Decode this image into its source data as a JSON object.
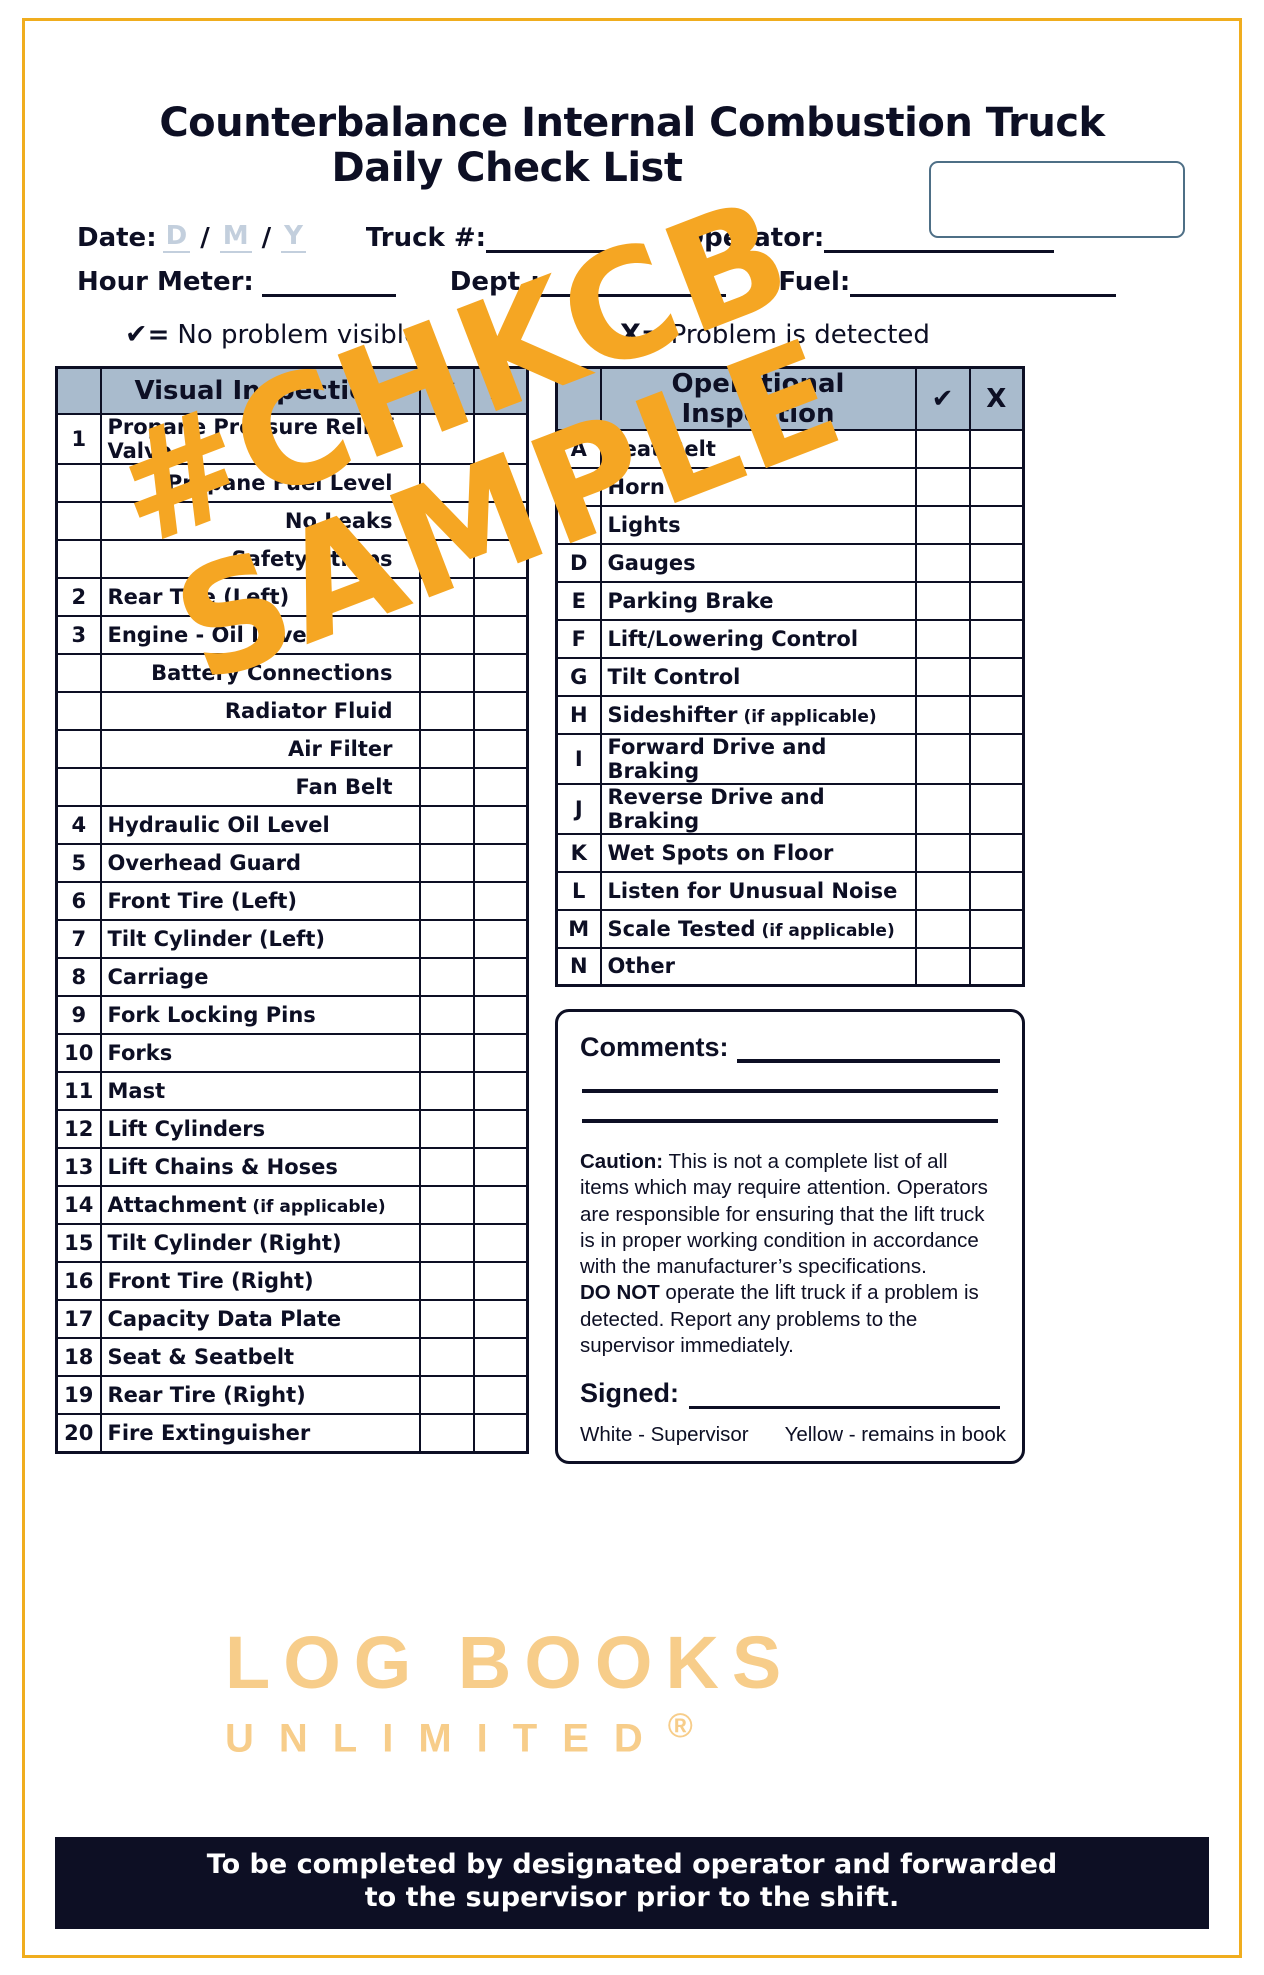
{
  "title": {
    "line1": "Counterbalance Internal Combustion Truck",
    "line2": "Daily Check List"
  },
  "header_fields": {
    "date_label": "Date:",
    "date_day": "D",
    "date_sep1": "/",
    "date_month": "M",
    "date_sep2": "/",
    "date_year": "Y",
    "truck_label": "Truck #:",
    "operator_label": "Operator:",
    "hour_meter_label": "Hour Meter:",
    "dept_label": "Dept.:",
    "fuel_label": "Fuel:"
  },
  "legend": {
    "check_symbol": "✔",
    "check_equals": "=",
    "check_text": "No problem visible",
    "x_symbol": "X",
    "x_equals": "=",
    "x_text": "Problem is detected"
  },
  "visual_table": {
    "header_title": "Visual Inspection",
    "header_check": "✔",
    "header_x": "X",
    "rows": [
      {
        "num": "1",
        "item": "Propane Pressure Relief Valve",
        "sub": false
      },
      {
        "num": "",
        "item": "Propane Fuel Level",
        "sub": true
      },
      {
        "num": "",
        "item": "No Leaks",
        "sub": true
      },
      {
        "num": "",
        "item": "Safety Straps",
        "sub": true
      },
      {
        "num": "2",
        "item": "Rear Tire (Left)",
        "sub": false
      },
      {
        "num": "3",
        "item": "Engine - Oil Level",
        "sub": false
      },
      {
        "num": "",
        "item": "Battery Connections",
        "sub": true
      },
      {
        "num": "",
        "item": "Radiator Fluid",
        "sub": true
      },
      {
        "num": "",
        "item": "Air Filter",
        "sub": true
      },
      {
        "num": "",
        "item": "Fan Belt",
        "sub": true
      },
      {
        "num": "4",
        "item": "Hydraulic Oil Level",
        "sub": false
      },
      {
        "num": "5",
        "item": "Overhead Guard",
        "sub": false
      },
      {
        "num": "6",
        "item": "Front Tire (Left)",
        "sub": false
      },
      {
        "num": "7",
        "item": "Tilt Cylinder (Left)",
        "sub": false
      },
      {
        "num": "8",
        "item": "Carriage",
        "sub": false
      },
      {
        "num": "9",
        "item": "Fork Locking Pins",
        "sub": false
      },
      {
        "num": "10",
        "item": "Forks",
        "sub": false
      },
      {
        "num": "11",
        "item": "Mast",
        "sub": false
      },
      {
        "num": "12",
        "item": "Lift Cylinders",
        "sub": false
      },
      {
        "num": "13",
        "item": "Lift Chains & Hoses",
        "sub": false
      },
      {
        "num": "14",
        "item": "Attachment",
        "note": "(if applicable)",
        "sub": false
      },
      {
        "num": "15",
        "item": "Tilt Cylinder (Right)",
        "sub": false
      },
      {
        "num": "16",
        "item": "Front Tire (Right)",
        "sub": false
      },
      {
        "num": "17",
        "item": "Capacity Data Plate",
        "sub": false
      },
      {
        "num": "18",
        "item": "Seat & Seatbelt",
        "sub": false
      },
      {
        "num": "19",
        "item": "Rear Tire (Right)",
        "sub": false
      },
      {
        "num": "20",
        "item": "Fire Extinguisher",
        "sub": false
      }
    ]
  },
  "operational_table": {
    "header_title": "Operational Inspection",
    "header_check": "✔",
    "header_x": "X",
    "rows": [
      {
        "num": "A",
        "item": "Seat Belt"
      },
      {
        "num": "B",
        "item": "Horn"
      },
      {
        "num": "C",
        "item": "Lights"
      },
      {
        "num": "D",
        "item": "Gauges"
      },
      {
        "num": "E",
        "item": "Parking Brake"
      },
      {
        "num": "F",
        "item": "Lift/Lowering Control"
      },
      {
        "num": "G",
        "item": "Tilt Control"
      },
      {
        "num": "H",
        "item": "Sideshifter",
        "note": "(if applicable)"
      },
      {
        "num": "I",
        "item": "Forward Drive and Braking"
      },
      {
        "num": "J",
        "item": "Reverse Drive and Braking"
      },
      {
        "num": "K",
        "item": "Wet Spots on Floor"
      },
      {
        "num": "L",
        "item": "Listen for Unusual Noise"
      },
      {
        "num": "M",
        "item": "Scale Tested",
        "note": "(if applicable)"
      },
      {
        "num": "N",
        "item": "Other"
      }
    ]
  },
  "notes": {
    "comments_label": "Comments:",
    "caution_label": "Caution:",
    "caution_text": " This is not a complete list of all items which may require attention. Operators are responsible for ensuring that the lift truck is in proper working condition in accordance with the manufacturer’s specifications.",
    "donot_label": "DO NOT",
    "donot_text": " operate the lift truck if a problem is detected. Report any problems to the supervisor immediately.",
    "signed_label": "Signed:",
    "copy_white": "White - Supervisor",
    "copy_yellow": "Yellow - remains in book"
  },
  "footer": {
    "line1": "To be completed by designated operator and forwarded",
    "line2": "to the supervisor prior to the shift."
  },
  "watermarks": {
    "sample_line1": "#CHKCB",
    "sample_line2": "SAMPLE",
    "logo_line1": "LOG BOOKS",
    "logo_line2": "UNLIMITED",
    "logo_reg": "®"
  },
  "colors": {
    "accent_border": "#f0ad1e",
    "table_header_bg": "#a9bbcd",
    "ink": "#0d0f24",
    "watermark_orange": "#f5a623",
    "watermark_tan": "#f7cd8a",
    "placeholder_blue": "#c3cfdd"
  }
}
